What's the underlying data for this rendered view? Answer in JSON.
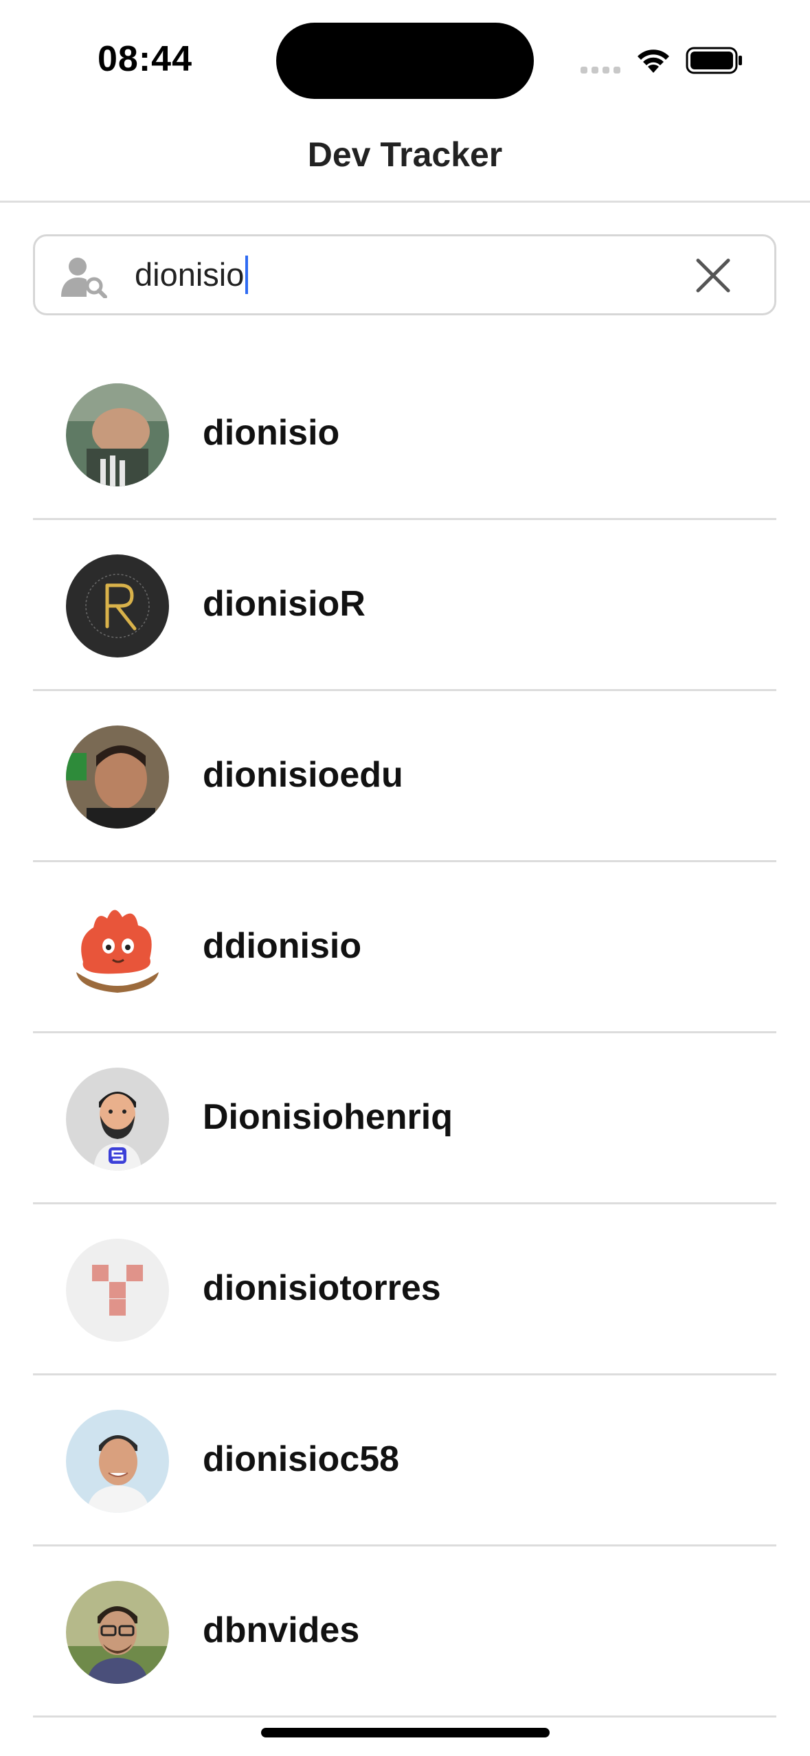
{
  "status_bar": {
    "time": "08:44",
    "wifi_icon": "wifi-icon",
    "battery_icon": "battery-icon"
  },
  "nav": {
    "title": "Dev Tracker"
  },
  "search": {
    "value": "dionisio",
    "icon": "person-search-icon",
    "clear_icon": "close-icon"
  },
  "users": [
    {
      "username": "dionisio",
      "avatar": "photo-man-outdoor"
    },
    {
      "username": "dionisioR",
      "avatar": "logo-letter-r"
    },
    {
      "username": "dionisioedu",
      "avatar": "photo-man-selfie"
    },
    {
      "username": "ddionisio",
      "avatar": "illustration-fire-creature"
    },
    {
      "username": "Dionisiohenriq",
      "avatar": "illustration-bearded-man"
    },
    {
      "username": "dionisiotorres",
      "avatar": "identicon-pink"
    },
    {
      "username": "dionisioc58",
      "avatar": "photo-man-smiling"
    },
    {
      "username": "dbnvides",
      "avatar": "photo-man-glasses"
    }
  ],
  "colors": {
    "accent_caret": "#2f6bf2",
    "divider": "#dcdcdc",
    "identicon": "#e0938a",
    "r_logo_gold": "#d9b24a"
  }
}
